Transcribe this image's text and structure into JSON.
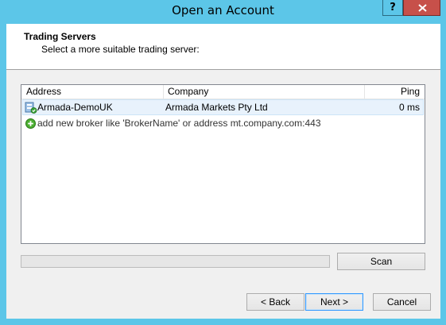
{
  "window": {
    "title": "Open an Account",
    "help_label": "?",
    "accent_color": "#5cc6e8",
    "close_color": "#c7504a"
  },
  "header": {
    "title": "Trading Servers",
    "subtitle": "Select a more suitable trading server:"
  },
  "servers_table": {
    "columns": [
      "Address",
      "Company",
      "Ping"
    ],
    "rows": [
      {
        "icon": "server-icon",
        "address": "Armada-DemoUK",
        "company": "Armada Markets Pty Ltd",
        "ping": "0 ms"
      }
    ],
    "add_row": {
      "icon": "add-plus-icon",
      "text": "add new broker like 'BrokerName' or address mt.company.com:443"
    }
  },
  "scan": {
    "progress": 0,
    "button_label": "Scan"
  },
  "footer": {
    "back_label": "< Back",
    "next_label": "Next >",
    "cancel_label": "Cancel"
  }
}
